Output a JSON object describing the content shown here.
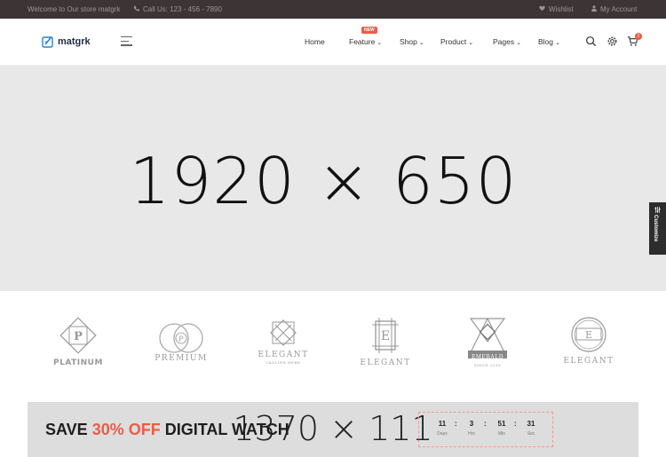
{
  "topbar": {
    "welcome": "Welcome to Our store matgrk",
    "call": "Call Us: 123 - 456 - 7890",
    "wishlist": "Wishlist",
    "account": "My Account"
  },
  "header": {
    "logo_text": "matgrk",
    "nav": {
      "home": "Home",
      "feature": "Feature",
      "feature_badge": "NEW",
      "shop": "Shop",
      "product": "Product",
      "pages": "Pages",
      "blog": "Blog"
    },
    "cart_count": "2"
  },
  "hero": {
    "placeholder": "1920 × 650"
  },
  "customize": {
    "label": "Customize"
  },
  "brands": {
    "platinum": "PLATINUM",
    "premium": "PREMIUM",
    "elegant_1": "ELEGANT",
    "elegant_1_tag": "TAGLINE HERE",
    "elegant_2": "ELEGANT",
    "emerald": "EMERALD",
    "emerald_tag": "SINCE 2018",
    "elegant_3": "ELEGANT"
  },
  "promo": {
    "placeholder": "1370 × 111",
    "title_prefix": "SAVE ",
    "title_highlight": "30% OFF",
    "title_suffix": " DIGITAL WATCH",
    "countdown": {
      "days": "11",
      "days_label": "Days",
      "hrs": "3",
      "hrs_label": "Hrs",
      "min": "51",
      "min_label": "Min",
      "sec": "31",
      "sec_label": "Sec"
    }
  },
  "colors": {
    "accent": "#ed5b47",
    "topbar": "#3d3535",
    "hero_bg": "#e8e8e8",
    "promo_bg": "#dddddd"
  },
  "icons": [
    "heart-icon",
    "user-icon",
    "phone-icon",
    "menu-icon",
    "search-icon",
    "gear-icon",
    "cart-icon"
  ]
}
